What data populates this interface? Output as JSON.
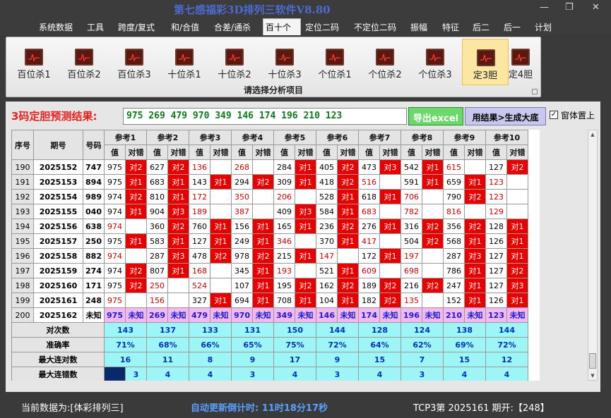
{
  "app_title": "第七感福彩3D排列三软件V8.80",
  "window_controls": {
    "minimize": "—",
    "maximize": "❐",
    "close": "✕"
  },
  "menu": [
    "系统数据",
    "工具",
    "跨度/复式",
    "和/合值",
    "合差/通杀",
    "百十个",
    "定位二码",
    "不定位二码",
    "振幅",
    "特征",
    "后二",
    "后一",
    "计划"
  ],
  "menu_active": "百十个",
  "ribbon": {
    "buttons": [
      "百位杀1",
      "百位杀2",
      "百位杀3",
      "十位杀1",
      "十位杀2",
      "十位杀3",
      "个位杀1",
      "个位杀2",
      "个位杀3",
      "定3胆",
      "定4胆"
    ],
    "active_button": "定3胆",
    "caption": "请选择分析项目"
  },
  "prediction": {
    "label": "3码定胆预测结果:",
    "value": "975 269 479 970 349 146 174 196 210 123",
    "export_btn": "导出excel",
    "generate_btn": "用结果>生成大底",
    "topmost_checked": true,
    "topmost_label": "窗体置上"
  },
  "table": {
    "headers": {
      "rownum": "序号",
      "period": "期号",
      "code": "号码",
      "val": "值",
      "judge": "对错"
    },
    "refs": [
      "参考1",
      "参考2",
      "参考3",
      "参考4",
      "参考5",
      "参考6",
      "参考7",
      "参考8",
      "参考9",
      "参考10"
    ],
    "rows": [
      {
        "n": "190",
        "p": "2025152",
        "c": "747",
        "cells": [
          [
            "975",
            "对2"
          ],
          [
            "627",
            "对2"
          ],
          [
            "136",
            ""
          ],
          [
            "268",
            ""
          ],
          [
            "284",
            "对1"
          ],
          [
            "405",
            "对2"
          ],
          [
            "473",
            "对3"
          ],
          [
            "542",
            "对1"
          ],
          [
            "615",
            ""
          ],
          [
            "127",
            "对2"
          ]
        ]
      },
      {
        "n": "191",
        "p": "2025153",
        "c": "894",
        "cells": [
          [
            "975",
            "对1"
          ],
          [
            "683",
            "对1"
          ],
          [
            "143",
            "对1"
          ],
          [
            "294",
            "对2"
          ],
          [
            "309",
            "对1"
          ],
          [
            "418",
            "对2"
          ],
          [
            "516",
            ""
          ],
          [
            "591",
            "对1"
          ],
          [
            "659",
            "对1"
          ],
          [
            "123",
            ""
          ]
        ]
      },
      {
        "n": "192",
        "p": "2025154",
        "c": "989",
        "cells": [
          [
            "974",
            "对2"
          ],
          [
            "810",
            "对1"
          ],
          [
            "172",
            ""
          ],
          [
            "350",
            ""
          ],
          [
            "206",
            ""
          ],
          [
            "528",
            "对1"
          ],
          [
            "618",
            "对1"
          ],
          [
            "706",
            ""
          ],
          [
            "790",
            "对2"
          ],
          [
            "123",
            ""
          ]
        ]
      },
      {
        "n": "193",
        "p": "2025155",
        "c": "040",
        "cells": [
          [
            "974",
            "对1"
          ],
          [
            "904",
            "对3"
          ],
          [
            "189",
            ""
          ],
          [
            "387",
            ""
          ],
          [
            "409",
            "对3"
          ],
          [
            "584",
            "对1"
          ],
          [
            "683",
            ""
          ],
          [
            "782",
            ""
          ],
          [
            "816",
            ""
          ],
          [
            "129",
            ""
          ]
        ]
      },
      {
        "n": "194",
        "p": "2025156",
        "c": "638",
        "cells": [
          [
            "974",
            ""
          ],
          [
            "360",
            "对2"
          ],
          [
            "760",
            "对1"
          ],
          [
            "156",
            "对1"
          ],
          [
            "165",
            "对1"
          ],
          [
            "236",
            "对2"
          ],
          [
            "276",
            "对1"
          ],
          [
            "316",
            "对2"
          ],
          [
            "356",
            "对2"
          ],
          [
            "128",
            "对1"
          ]
        ]
      },
      {
        "n": "195",
        "p": "2025157",
        "c": "250",
        "cells": [
          [
            "975",
            "对1"
          ],
          [
            "583",
            "对1"
          ],
          [
            "127",
            "对1"
          ],
          [
            "249",
            "对1"
          ],
          [
            "346",
            ""
          ],
          [
            "370",
            "对1"
          ],
          [
            "417",
            ""
          ],
          [
            "504",
            "对2"
          ],
          [
            "568",
            "对1"
          ],
          [
            "126",
            "对1"
          ]
        ]
      },
      {
        "n": "196",
        "p": "2025158",
        "c": "882",
        "cells": [
          [
            "974",
            ""
          ],
          [
            "287",
            "对3"
          ],
          [
            "478",
            "对2"
          ],
          [
            "978",
            "对2"
          ],
          [
            "215",
            "对1"
          ],
          [
            "147",
            ""
          ],
          [
            "172",
            "对1"
          ],
          [
            "197",
            ""
          ],
          [
            "287",
            "对3"
          ],
          [
            "127",
            "对1"
          ]
        ]
      },
      {
        "n": "197",
        "p": "2025159",
        "c": "274",
        "cells": [
          [
            "974",
            "对2"
          ],
          [
            "807",
            "对1"
          ],
          [
            "168",
            ""
          ],
          [
            "345",
            "对1"
          ],
          [
            "193",
            ""
          ],
          [
            "521",
            "对1"
          ],
          [
            "609",
            ""
          ],
          [
            "698",
            ""
          ],
          [
            "786",
            "对1"
          ],
          [
            "127",
            "对2"
          ]
        ]
      },
      {
        "n": "198",
        "p": "2025160",
        "c": "171",
        "cells": [
          [
            "975",
            "对2"
          ],
          [
            "250",
            ""
          ],
          [
            "524",
            ""
          ],
          [
            "107",
            "对1"
          ],
          [
            "195",
            "对2"
          ],
          [
            "162",
            "对2"
          ],
          [
            "189",
            "对2"
          ],
          [
            "216",
            "对2"
          ],
          [
            "247",
            "对1"
          ],
          [
            "127",
            "对3"
          ]
        ]
      },
      {
        "n": "199",
        "p": "2025161",
        "c": "248",
        "cells": [
          [
            "975",
            ""
          ],
          [
            "156",
            ""
          ],
          [
            "327",
            "对1"
          ],
          [
            "694",
            "对1"
          ],
          [
            "708",
            "对1"
          ],
          [
            "104",
            "对1"
          ],
          [
            "182",
            "对2"
          ],
          [
            "135",
            ""
          ],
          [
            "152",
            "对1"
          ],
          [
            "126",
            "对1"
          ]
        ]
      }
    ],
    "pending_row": {
      "n": "200",
      "p": "2025162",
      "c": "未知",
      "vals": [
        "975",
        "269",
        "479",
        "970",
        "349",
        "146",
        "174",
        "196",
        "210",
        "123"
      ],
      "judge": "未知"
    },
    "stats": [
      {
        "label": "对次数",
        "vals": [
          "143",
          "137",
          "133",
          "131",
          "150",
          "144",
          "128",
          "124",
          "138",
          "144"
        ]
      },
      {
        "label": "准确率",
        "vals": [
          "71%",
          "68%",
          "66%",
          "65%",
          "75%",
          "72%",
          "64%",
          "62%",
          "69%",
          "72%"
        ]
      },
      {
        "label": "最大连对数",
        "vals": [
          "16",
          "11",
          "8",
          "9",
          "17",
          "9",
          "15",
          "7",
          "15",
          "12"
        ]
      },
      {
        "label": "最大连错数",
        "vals": [
          "3",
          "4",
          "4",
          "3",
          "4",
          "3",
          "4",
          "3",
          "4",
          "4"
        ]
      }
    ]
  },
  "status": {
    "current": "当前数据为:[体彩排列三]",
    "countdown": "自动更新倒计时:  11时18分17秒",
    "draw": "TCP3第  2025161  期开:【248】"
  },
  "colors": {
    "error_red": "#e80000",
    "stat_cyan": "#9df5f5",
    "pending_pink": "#f2b8f2",
    "title_blue": "#4b6bd0"
  }
}
